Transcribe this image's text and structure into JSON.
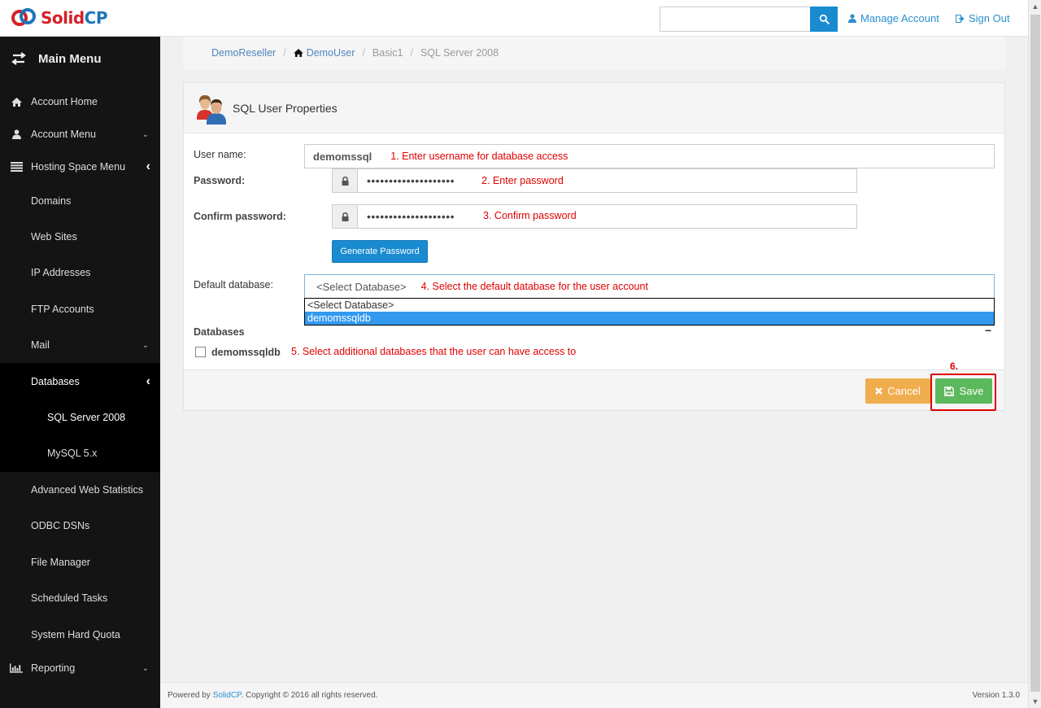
{
  "header": {
    "brand_part1": "Solid",
    "brand_part2": "CP",
    "search": {
      "value": "",
      "placeholder": ""
    },
    "manage_account": "Manage Account",
    "sign_out": "Sign Out"
  },
  "sidebar": {
    "title": "Main Menu",
    "items": [
      {
        "label": "Account Home",
        "icon": "home-icon"
      },
      {
        "label": "Account Menu",
        "icon": "user-icon",
        "expander": "chevron-down"
      },
      {
        "label": "Hosting Space Menu",
        "icon": "list-icon",
        "expander": "chevron-left"
      },
      {
        "label": "Domains"
      },
      {
        "label": "Web Sites"
      },
      {
        "label": "IP Addresses"
      },
      {
        "label": "FTP Accounts"
      },
      {
        "label": "Mail",
        "expander": "chevron-down"
      },
      {
        "label": "Databases",
        "expander": "chevron-left",
        "active": true
      },
      {
        "label": "SQL Server 2008",
        "active": true
      },
      {
        "label": "MySQL 5.x"
      },
      {
        "label": "Advanced Web Statistics"
      },
      {
        "label": "ODBC DSNs"
      },
      {
        "label": "File Manager"
      },
      {
        "label": "Scheduled Tasks"
      },
      {
        "label": "System Hard Quota"
      },
      {
        "label": "Reporting",
        "icon": "bar-chart-icon",
        "expander": "chevron-down"
      }
    ]
  },
  "breadcrumb": [
    {
      "label": "DemoReseller",
      "link": true
    },
    {
      "label": "DemoUser",
      "link": true,
      "icon": "home-icon"
    },
    {
      "label": "Basic1",
      "link": false
    },
    {
      "label": "SQL Server 2008",
      "link": false
    }
  ],
  "panel": {
    "title": "SQL User Properties",
    "username": {
      "label": "User name:",
      "value": "demomssql",
      "annotation": "1. Enter username for database access"
    },
    "password": {
      "label": "Password:",
      "value": "••••••••••••••••••••",
      "annotation": "2. Enter password"
    },
    "confirm_password": {
      "label": "Confirm password:",
      "value": "••••••••••••••••••••",
      "annotation": "3. Confirm password"
    },
    "generate_password": "Generate Password",
    "default_database": {
      "label": "Default database:",
      "selected": "<Select Database>",
      "annotation": "4. Select the default database for the user account",
      "options": [
        "<Select Database>",
        "demomssqldb"
      ],
      "highlighted": "demomssqldb"
    },
    "databases": {
      "label": "Databases",
      "collapse": "−",
      "items": [
        {
          "name": "demomssqldb",
          "checked": false
        }
      ],
      "annotation": "5. Select additional databases that the user can have access to"
    },
    "save_annotation": "6.",
    "cancel": "Cancel",
    "save": "Save"
  },
  "footer": {
    "powered_prefix": "Powered by ",
    "powered_link": "SolidCP",
    "copyright": ". Copyright © 2016 all rights reserved.",
    "version": "Version 1.3.0"
  },
  "colors": {
    "primary": "#1a8bd0",
    "sidebar_bg": "#141414",
    "annotation": "#e00000",
    "cancel": "#f0ad4e",
    "save": "#5cb85c",
    "dropdown_highlight": "#3399ee"
  }
}
